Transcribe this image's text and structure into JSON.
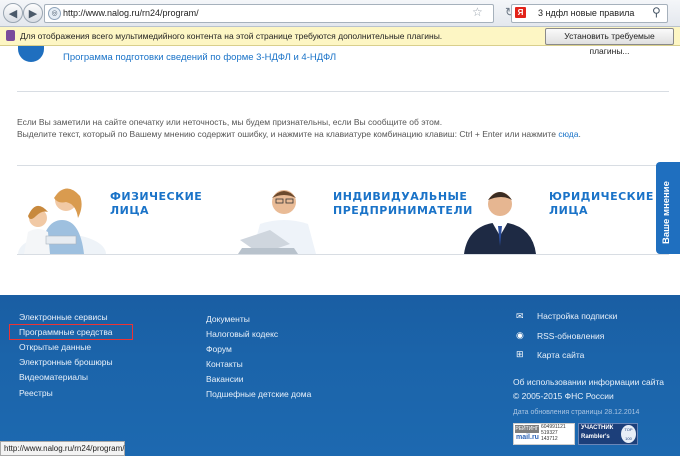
{
  "browser": {
    "back_icon": "back-arrow-icon",
    "forward_icon": "forward-arrow-icon",
    "url": "http://www.nalog.ru/rn24/program/",
    "search_engine": "Я",
    "search_text": "3 ндфл новые правила"
  },
  "plugin_bar": {
    "message": "Для отображения всего мультимедийного контента на этой странице требуются дополнительные плагины.",
    "button_label": "Установить требуемые плагины..."
  },
  "page": {
    "program_link": "Программа подготовки сведений по форме 3-НДФЛ и 4-НДФЛ",
    "typo_line1": "Если Вы заметили на сайте опечатку или неточность, мы будем признательны, если Вы сообщите об этом.",
    "typo_line2": "Выделите текст, который по Вашему мнению содержит ошибку, и нажмите на клавиатуре комбинацию клавиш: Ctrl + Enter или нажмите",
    "typo_link": "сюда",
    "typo_end": ".",
    "categories": [
      {
        "line1": "ФИЗИЧЕСКИЕ",
        "line2": "ЛИЦА"
      },
      {
        "line1": "ИНДИВИДУАЛЬНЫЕ",
        "line2": "ПРЕДПРИНИМАТЕЛИ"
      },
      {
        "line1": "ЮРИДИЧЕСКИЕ",
        "line2": "ЛИЦА"
      }
    ],
    "feedback_tab": "Ваше мнение"
  },
  "footer": {
    "col1": [
      "Электронные сервисы",
      "Программные средства",
      "Открытые данные",
      "Электронные брошюры",
      "Видеоматериалы",
      "Реестры"
    ],
    "col2": [
      "Документы",
      "Налоговый кодекс",
      "Форум",
      "Контакты",
      "Вакансии",
      "Подшефные детские дома"
    ],
    "col3": [
      {
        "icon": "mail-icon",
        "label": "Настройка подписки"
      },
      {
        "icon": "rss-icon",
        "label": "RSS-обновления"
      },
      {
        "icon": "sitemap-icon",
        "label": "Карта сайта"
      }
    ],
    "info_link": "Об использовании информации сайта",
    "copyright": "© 2005-2015 ФНС России",
    "update_date": "Дата обновления страницы 28.12.2014",
    "badge1_title": "РЕЙТИНГ",
    "badge1_site": "mail.ru",
    "badge1_nums": [
      "604991121",
      "519327",
      "143712"
    ],
    "badge2_title": "УЧАСТНИК",
    "badge2_site": "Rambler's",
    "badge2_top": "TOP 100"
  },
  "status_bar": {
    "text": "http://www.nalog.ru/rn24/program/"
  },
  "colors": {
    "accent": "#1a73c8",
    "footer_bg": "#1b64aa",
    "highlight": "#e33333"
  }
}
